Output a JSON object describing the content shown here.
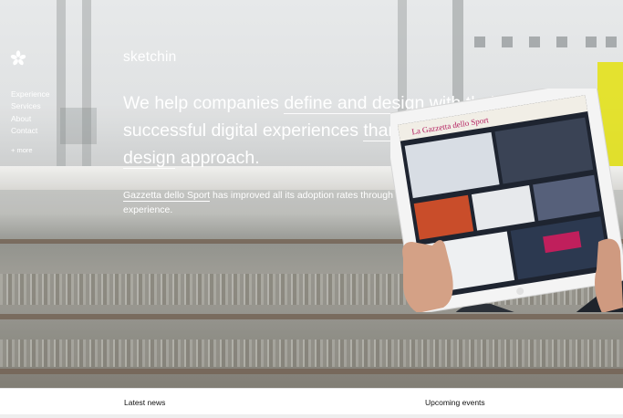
{
  "brand": "sketchin",
  "nav": {
    "items": [
      "Experience",
      "Services",
      "About",
      "Contact"
    ],
    "more": "+ more"
  },
  "headline": {
    "part1": "We help companies ",
    "link1": "define and design",
    "part2": " with their clients successful digital experiences ",
    "link2": "thanks to our evolutive design",
    "part3": " approach."
  },
  "case": {
    "client": "Gazzetta dello Sport",
    "text": " has improved all its adoption rates through a new sports information user experience."
  },
  "footer": {
    "latest_news": "Latest news",
    "upcoming_events": "Upcoming events"
  },
  "tablet": {
    "masthead": "La Gazzetta dello Sport"
  },
  "colors": {
    "text_on_hero": "#ffffff",
    "accent_yellow": "#e3e000",
    "footer_text": "#111111"
  }
}
